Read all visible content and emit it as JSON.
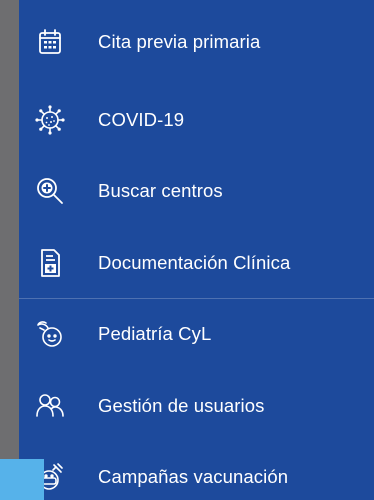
{
  "menu": {
    "items": [
      {
        "label": "Cita previa primaria",
        "icon": "calendar-icon"
      },
      {
        "label": "COVID-19",
        "icon": "virus-icon"
      },
      {
        "label": "Buscar centros",
        "icon": "search-plus-icon"
      },
      {
        "label": "Documentación Clínica",
        "icon": "document-cross-icon"
      },
      {
        "label": "Pediatría CyL",
        "icon": "baby-icon"
      },
      {
        "label": "Gestión de usuarios",
        "icon": "users-icon"
      },
      {
        "label": "Campañas vacunación",
        "icon": "vaccination-icon"
      }
    ]
  },
  "colors": {
    "menu_background": "#1d4a9c",
    "backdrop": "#6e6e70",
    "foreground": "#ffffff",
    "corner_accent": "#56b2ea"
  }
}
